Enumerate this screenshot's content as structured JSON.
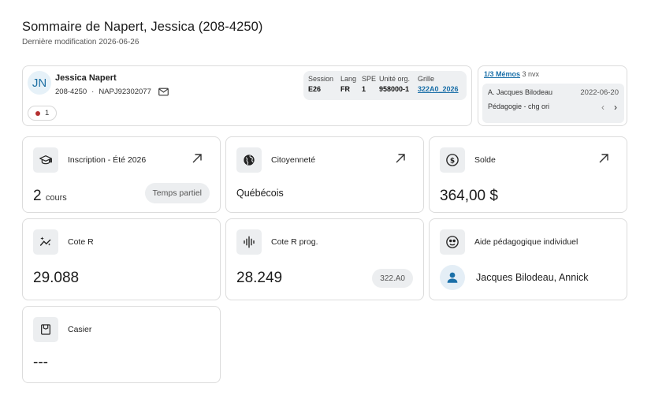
{
  "header": {
    "title": "Sommaire de Napert, Jessica (208-4250)",
    "subtitle": "Dernière modification 2026-06-26"
  },
  "profile": {
    "initials": "JN",
    "name": "Jessica Napert",
    "id": "208-4250",
    "separator": "·",
    "code": "NAPJ92302077",
    "alert_count": "1",
    "info": {
      "headers": [
        "Session",
        "Lang",
        "SPE",
        "Unité org.",
        "Grille"
      ],
      "values": [
        "E26",
        "FR",
        "1",
        "958000-1",
        "322A0_2026"
      ]
    }
  },
  "memo": {
    "link": "1/3 Mémos",
    "new_count": "3 nvx",
    "author": "A. Jacques Bilodeau",
    "date": "2022-06-20",
    "text": "Pédagogie - chg ori",
    "prev": "‹",
    "next": "›"
  },
  "cards": {
    "inscription": {
      "label": "Inscription - Été 2026",
      "value": "2",
      "unit": "cours",
      "badge": "Temps partiel"
    },
    "citoyennete": {
      "label": "Citoyenneté",
      "value": "Québécois"
    },
    "solde": {
      "label": "Solde",
      "value": "364,00 $"
    },
    "cote_r": {
      "label": "Cote R",
      "value": "29.088"
    },
    "cote_r_prog": {
      "label": "Cote R prog.",
      "value": "28.249",
      "badge": "322.A0"
    },
    "aide": {
      "label": "Aide pédagogique individuel",
      "advisor": "Jacques Bilodeau, Annick"
    },
    "casier": {
      "label": "Casier",
      "value": "---"
    }
  },
  "colors": {
    "accent": "#1a6fa8",
    "alert": "#b53030",
    "icon_bg": "#eceef0"
  }
}
